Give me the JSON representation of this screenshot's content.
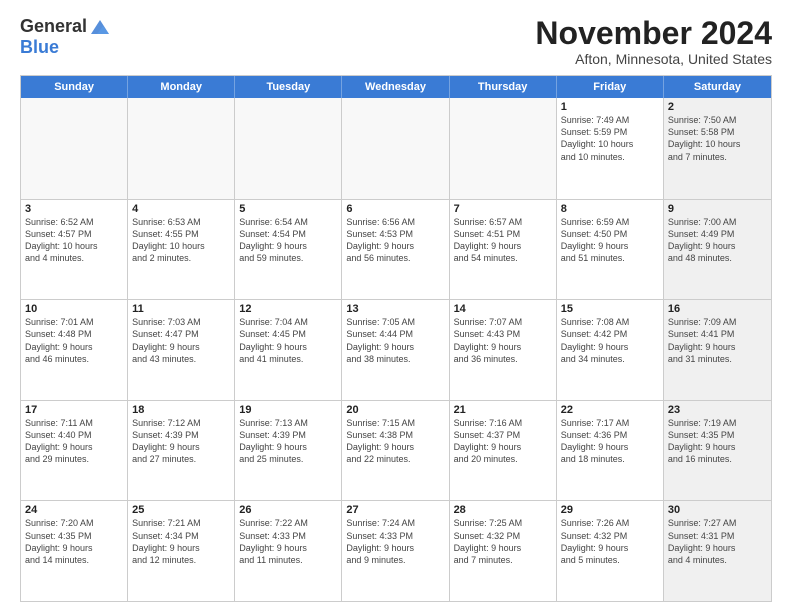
{
  "logo": {
    "general": "General",
    "blue": "Blue"
  },
  "title": "November 2024",
  "location": "Afton, Minnesota, United States",
  "header_days": [
    "Sunday",
    "Monday",
    "Tuesday",
    "Wednesday",
    "Thursday",
    "Friday",
    "Saturday"
  ],
  "weeks": [
    [
      {
        "day": "",
        "info": "",
        "empty": true
      },
      {
        "day": "",
        "info": "",
        "empty": true
      },
      {
        "day": "",
        "info": "",
        "empty": true
      },
      {
        "day": "",
        "info": "",
        "empty": true
      },
      {
        "day": "",
        "info": "",
        "empty": true
      },
      {
        "day": "1",
        "info": "Sunrise: 7:49 AM\nSunset: 5:59 PM\nDaylight: 10 hours\nand 10 minutes.",
        "empty": false
      },
      {
        "day": "2",
        "info": "Sunrise: 7:50 AM\nSunset: 5:58 PM\nDaylight: 10 hours\nand 7 minutes.",
        "empty": false,
        "shaded": true
      }
    ],
    [
      {
        "day": "3",
        "info": "Sunrise: 6:52 AM\nSunset: 4:57 PM\nDaylight: 10 hours\nand 4 minutes.",
        "empty": false
      },
      {
        "day": "4",
        "info": "Sunrise: 6:53 AM\nSunset: 4:55 PM\nDaylight: 10 hours\nand 2 minutes.",
        "empty": false
      },
      {
        "day": "5",
        "info": "Sunrise: 6:54 AM\nSunset: 4:54 PM\nDaylight: 9 hours\nand 59 minutes.",
        "empty": false
      },
      {
        "day": "6",
        "info": "Sunrise: 6:56 AM\nSunset: 4:53 PM\nDaylight: 9 hours\nand 56 minutes.",
        "empty": false
      },
      {
        "day": "7",
        "info": "Sunrise: 6:57 AM\nSunset: 4:51 PM\nDaylight: 9 hours\nand 54 minutes.",
        "empty": false
      },
      {
        "day": "8",
        "info": "Sunrise: 6:59 AM\nSunset: 4:50 PM\nDaylight: 9 hours\nand 51 minutes.",
        "empty": false
      },
      {
        "day": "9",
        "info": "Sunrise: 7:00 AM\nSunset: 4:49 PM\nDaylight: 9 hours\nand 48 minutes.",
        "empty": false,
        "shaded": true
      }
    ],
    [
      {
        "day": "10",
        "info": "Sunrise: 7:01 AM\nSunset: 4:48 PM\nDaylight: 9 hours\nand 46 minutes.",
        "empty": false
      },
      {
        "day": "11",
        "info": "Sunrise: 7:03 AM\nSunset: 4:47 PM\nDaylight: 9 hours\nand 43 minutes.",
        "empty": false
      },
      {
        "day": "12",
        "info": "Sunrise: 7:04 AM\nSunset: 4:45 PM\nDaylight: 9 hours\nand 41 minutes.",
        "empty": false
      },
      {
        "day": "13",
        "info": "Sunrise: 7:05 AM\nSunset: 4:44 PM\nDaylight: 9 hours\nand 38 minutes.",
        "empty": false
      },
      {
        "day": "14",
        "info": "Sunrise: 7:07 AM\nSunset: 4:43 PM\nDaylight: 9 hours\nand 36 minutes.",
        "empty": false
      },
      {
        "day": "15",
        "info": "Sunrise: 7:08 AM\nSunset: 4:42 PM\nDaylight: 9 hours\nand 34 minutes.",
        "empty": false
      },
      {
        "day": "16",
        "info": "Sunrise: 7:09 AM\nSunset: 4:41 PM\nDaylight: 9 hours\nand 31 minutes.",
        "empty": false,
        "shaded": true
      }
    ],
    [
      {
        "day": "17",
        "info": "Sunrise: 7:11 AM\nSunset: 4:40 PM\nDaylight: 9 hours\nand 29 minutes.",
        "empty": false
      },
      {
        "day": "18",
        "info": "Sunrise: 7:12 AM\nSunset: 4:39 PM\nDaylight: 9 hours\nand 27 minutes.",
        "empty": false
      },
      {
        "day": "19",
        "info": "Sunrise: 7:13 AM\nSunset: 4:39 PM\nDaylight: 9 hours\nand 25 minutes.",
        "empty": false
      },
      {
        "day": "20",
        "info": "Sunrise: 7:15 AM\nSunset: 4:38 PM\nDaylight: 9 hours\nand 22 minutes.",
        "empty": false
      },
      {
        "day": "21",
        "info": "Sunrise: 7:16 AM\nSunset: 4:37 PM\nDaylight: 9 hours\nand 20 minutes.",
        "empty": false
      },
      {
        "day": "22",
        "info": "Sunrise: 7:17 AM\nSunset: 4:36 PM\nDaylight: 9 hours\nand 18 minutes.",
        "empty": false
      },
      {
        "day": "23",
        "info": "Sunrise: 7:19 AM\nSunset: 4:35 PM\nDaylight: 9 hours\nand 16 minutes.",
        "empty": false,
        "shaded": true
      }
    ],
    [
      {
        "day": "24",
        "info": "Sunrise: 7:20 AM\nSunset: 4:35 PM\nDaylight: 9 hours\nand 14 minutes.",
        "empty": false
      },
      {
        "day": "25",
        "info": "Sunrise: 7:21 AM\nSunset: 4:34 PM\nDaylight: 9 hours\nand 12 minutes.",
        "empty": false
      },
      {
        "day": "26",
        "info": "Sunrise: 7:22 AM\nSunset: 4:33 PM\nDaylight: 9 hours\nand 11 minutes.",
        "empty": false
      },
      {
        "day": "27",
        "info": "Sunrise: 7:24 AM\nSunset: 4:33 PM\nDaylight: 9 hours\nand 9 minutes.",
        "empty": false
      },
      {
        "day": "28",
        "info": "Sunrise: 7:25 AM\nSunset: 4:32 PM\nDaylight: 9 hours\nand 7 minutes.",
        "empty": false
      },
      {
        "day": "29",
        "info": "Sunrise: 7:26 AM\nSunset: 4:32 PM\nDaylight: 9 hours\nand 5 minutes.",
        "empty": false
      },
      {
        "day": "30",
        "info": "Sunrise: 7:27 AM\nSunset: 4:31 PM\nDaylight: 9 hours\nand 4 minutes.",
        "empty": false,
        "shaded": true
      }
    ]
  ]
}
